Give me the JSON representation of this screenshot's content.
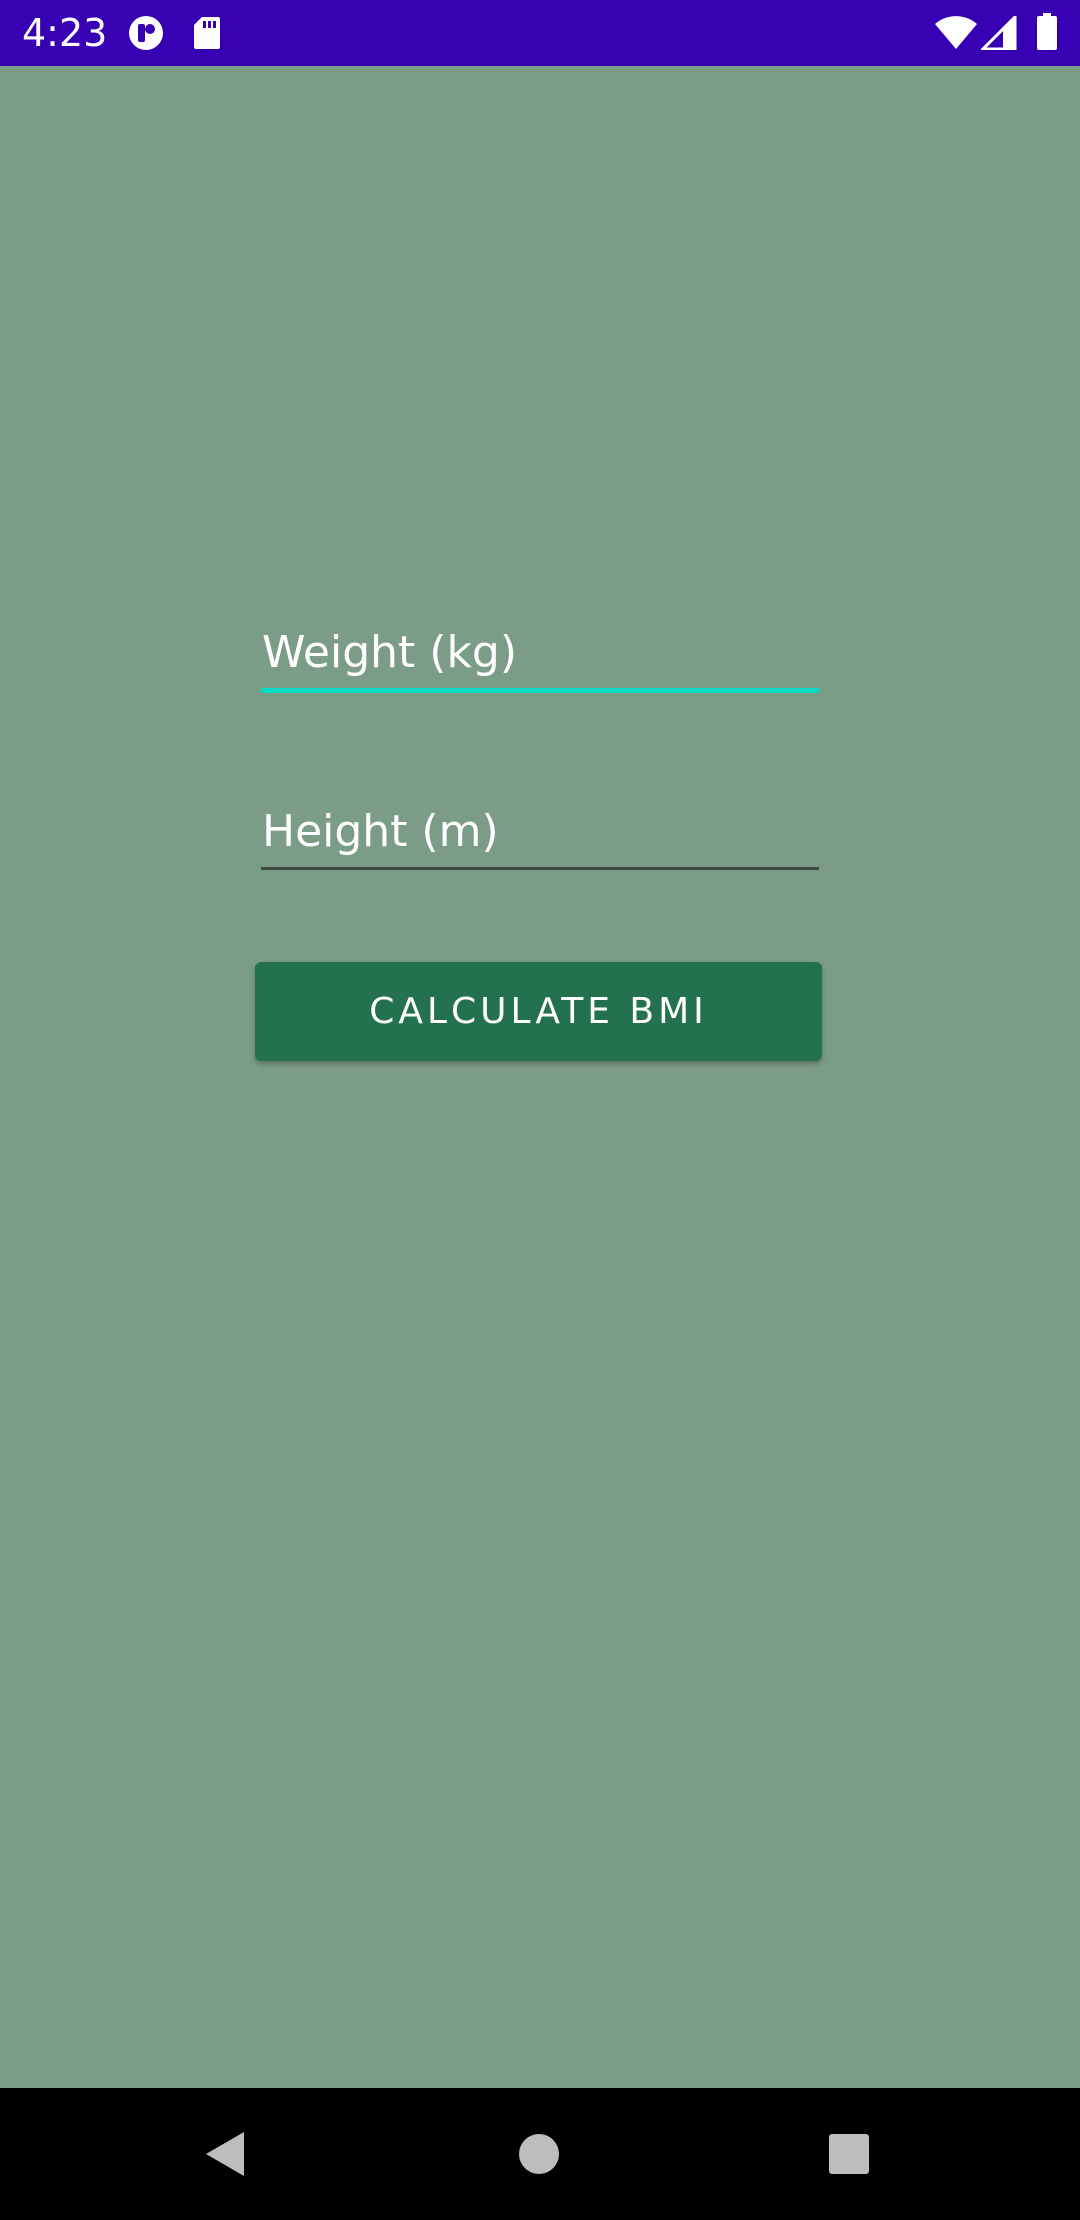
{
  "status_bar": {
    "time": "4:23",
    "background_color": "#3700b3",
    "left_icons": [
      "app-notification-icon",
      "sd-card-icon"
    ],
    "right_icons": [
      "wifi-icon",
      "cellular-signal-icon",
      "battery-icon"
    ]
  },
  "form": {
    "weight": {
      "placeholder": "Weight (kg)",
      "value": "",
      "focused": true,
      "underline_color": "#03dac5"
    },
    "height": {
      "placeholder": "Height (m)",
      "value": "",
      "focused": false
    },
    "calculate_button": {
      "label": "CALCULATE BMI",
      "color": "#24714f"
    }
  },
  "navigation_bar": {
    "buttons": [
      "back-icon",
      "home-icon",
      "recents-icon"
    ]
  },
  "colors": {
    "background": "#7b9c87",
    "accent": "#03dac5",
    "primary": "#3700b3"
  }
}
